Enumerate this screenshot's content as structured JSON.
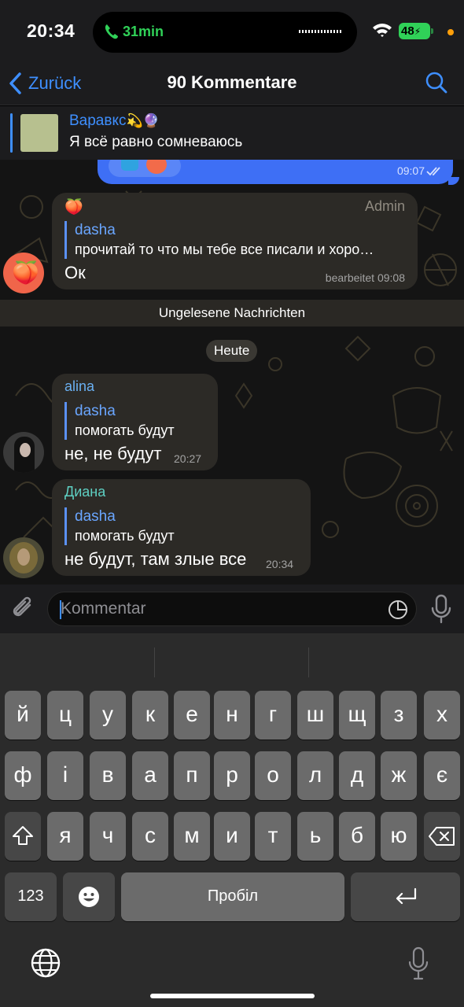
{
  "status_bar": {
    "time": "20:34",
    "call_duration": "31min",
    "battery": "48"
  },
  "nav": {
    "back_label": "Zurück",
    "title": "90 Kommentare"
  },
  "pinned": {
    "name": "Варавкс",
    "emoji": "💫🔮",
    "text": "Я всё равно сомневаюсь"
  },
  "messages": {
    "prev": {
      "time": "09:07"
    },
    "admin_msg": {
      "sender_emoji": "🍑",
      "badge": "Admin",
      "quote_name": "dasha",
      "quote_text": "прочитай то что мы тебе все писали и хоро…",
      "text": "Ок",
      "time": "bearbeitet 09:08"
    },
    "unread_label": "Ungelesene Nachrichten",
    "day_label": "Heute",
    "alina_msg": {
      "sender": "alina",
      "quote_name": "dasha",
      "quote_text": "помогать будут",
      "text": "не, не будут",
      "time": "20:27"
    },
    "diana_msg": {
      "sender": "Диана",
      "quote_name": "dasha",
      "quote_text": "помогать будут",
      "text": "не будут, там злые все",
      "time": "20:34"
    }
  },
  "composer": {
    "placeholder": "Kommentar"
  },
  "keyboard": {
    "row1": [
      "й",
      "ц",
      "у",
      "к",
      "е",
      "н",
      "г",
      "ш",
      "щ",
      "з",
      "х"
    ],
    "row2": [
      "ф",
      "і",
      "в",
      "а",
      "п",
      "р",
      "о",
      "л",
      "д",
      "ж",
      "є"
    ],
    "row3": [
      "я",
      "ч",
      "с",
      "м",
      "и",
      "т",
      "ь",
      "б",
      "ю"
    ],
    "numbers_key": "123",
    "space_key": "Пробіл"
  },
  "colors": {
    "accent": "#3e8fff",
    "call_green": "#30d158",
    "outgoing_bubble": "#3e6ff5"
  }
}
